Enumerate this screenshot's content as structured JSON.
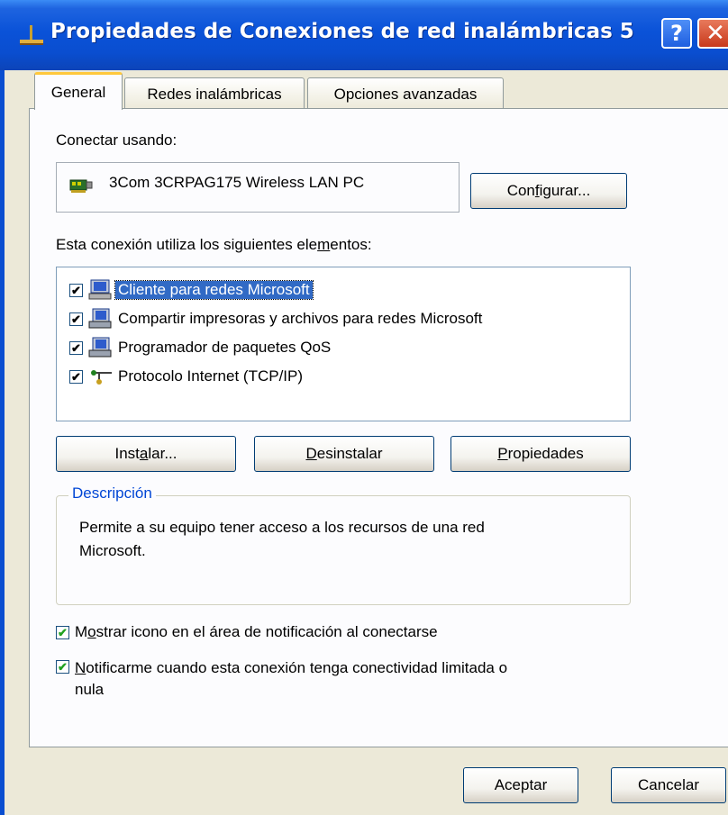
{
  "window": {
    "title": "Propiedades de Conexiones de red inalámbricas 5",
    "help_glyph": "?",
    "close_glyph": "✕"
  },
  "tabs": [
    {
      "label": "General",
      "active": true
    },
    {
      "label": "Redes inalámbricas",
      "active": false
    },
    {
      "label": "Opciones avanzadas",
      "active": false
    }
  ],
  "general": {
    "connect_using_label": "Conectar usando:",
    "adapter_name": "3Com 3CRPAG175 Wireless LAN PC",
    "configure_button": {
      "pre": "Con",
      "mnemonic": "f",
      "post": "igurar..."
    },
    "components_label": {
      "pre": "Esta conexión utiliza los siguientes ele",
      "mnemonic": "m",
      "post": "entos:"
    },
    "components": [
      {
        "label": "Cliente para redes Microsoft",
        "checked": true,
        "selected": true,
        "icon": "network-client-icon"
      },
      {
        "label": "Compartir impresoras y archivos para redes Microsoft",
        "checked": true,
        "selected": false,
        "icon": "network-service-icon"
      },
      {
        "label": "Programador de paquetes QoS",
        "checked": true,
        "selected": false,
        "icon": "network-service-icon"
      },
      {
        "label": "Protocolo Internet (TCP/IP)",
        "checked": true,
        "selected": false,
        "icon": "network-protocol-icon"
      }
    ],
    "install_button": {
      "pre": "Inst",
      "mnemonic": "a",
      "post": "lar..."
    },
    "uninstall_button": {
      "pre": "",
      "mnemonic": "D",
      "post": "esinstalar"
    },
    "properties_button": {
      "pre": "",
      "mnemonic": "P",
      "post": "ropiedades"
    },
    "description": {
      "title": "Descripción",
      "line1": "Permite a su equipo tener acceso a los recursos de una red",
      "line2": "Microsoft."
    },
    "show_icon": {
      "checked": true,
      "pre": "M",
      "mnemonic": "o",
      "post": "strar icono en el área de notificación al conectarse"
    },
    "notify": {
      "checked": true,
      "pre": "",
      "mnemonic": "N",
      "post": "otificarme cuando esta conexión tenga conectividad limitada o",
      "line2": "nula"
    }
  },
  "footer": {
    "ok_label": "Aceptar",
    "cancel_label": "Cancelar"
  },
  "colors": {
    "titlebar": "#0a4ed0",
    "dialog_bg": "#ece9d8",
    "selection": "#316ac5",
    "group_title": "#0046d5"
  }
}
